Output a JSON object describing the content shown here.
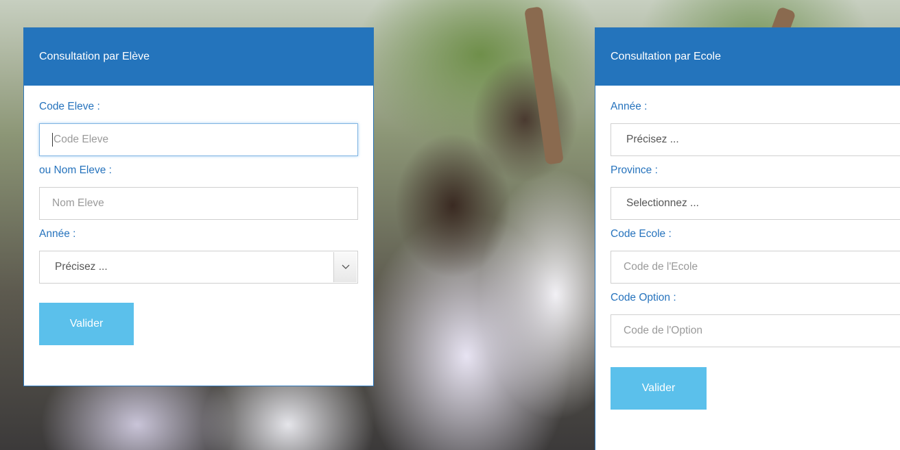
{
  "left_panel": {
    "title": "Consultation par Elève",
    "code_label": "Code Eleve :",
    "code_placeholder": "Code Eleve",
    "name_label": "ou Nom Eleve :",
    "name_placeholder": "Nom Eleve",
    "year_label": "Année :",
    "year_value": "Précisez ...",
    "submit_label": "Valider"
  },
  "right_panel": {
    "title": "Consultation par Ecole",
    "year_label": "Année :",
    "year_value": "Précisez ...",
    "province_label": "Province :",
    "province_value": "Selectionnez ...",
    "school_label": "Code Ecole :",
    "school_placeholder": "Code de l'Ecole",
    "option_label": "Code Option :",
    "option_placeholder": "Code de l'Option",
    "submit_label": "Valider"
  },
  "colors": {
    "header_blue": "#2474bc",
    "label_blue": "#2673bd",
    "button_blue": "#5bc0eb"
  },
  "icons": {
    "select_arrow": "chevron-down-icon"
  }
}
